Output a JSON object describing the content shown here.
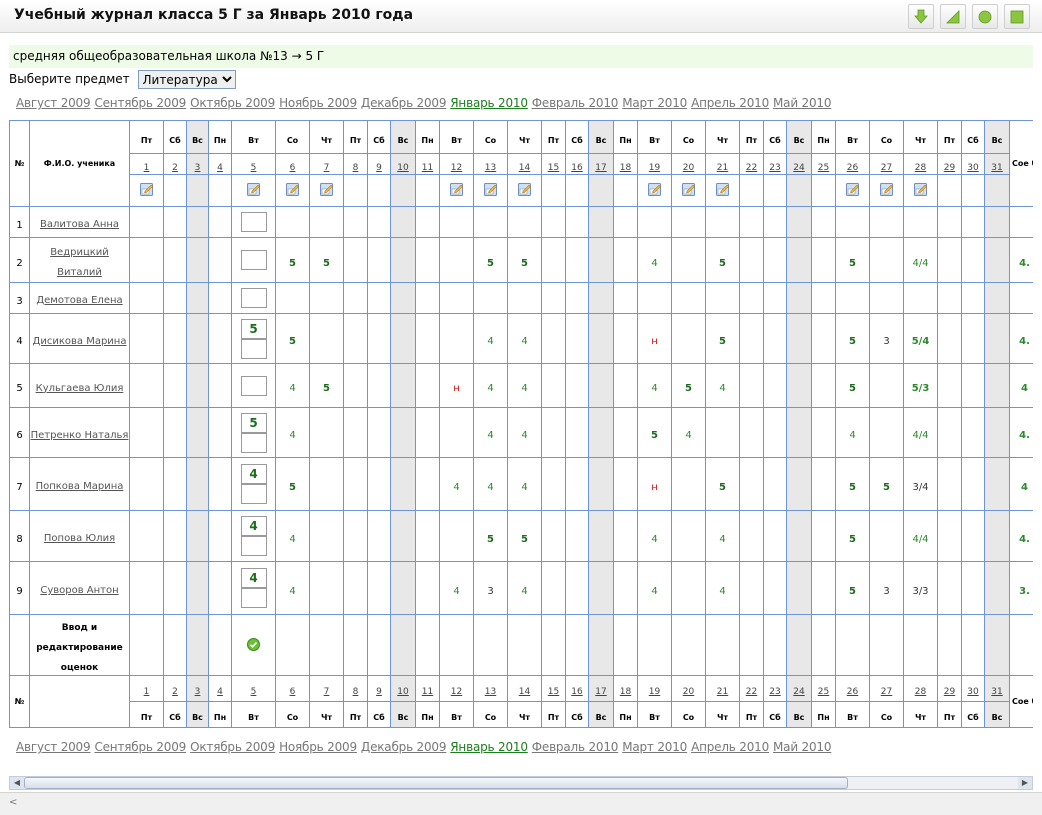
{
  "title": "Учебный журнал класса 5 Г за Январь 2010 года",
  "toolbar": {
    "icons": [
      "download-arrow-icon",
      "resize-corner-icon",
      "green-circle-icon",
      "green-square-icon"
    ]
  },
  "school_line": "средняя общеобразовательная школа №13 → 5 Г",
  "subject": {
    "label": "Выберите предмет",
    "selected": "Литература"
  },
  "months": [
    {
      "label": "Август 2009",
      "current": false
    },
    {
      "label": "Сентябрь 2009",
      "current": false
    },
    {
      "label": "Октябрь 2009",
      "current": false
    },
    {
      "label": "Ноябрь 2009",
      "current": false
    },
    {
      "label": "Декабрь 2009",
      "current": false
    },
    {
      "label": "Январь 2010",
      "current": true
    },
    {
      "label": "Февраль 2010",
      "current": false
    },
    {
      "label": "Март 2010",
      "current": false
    },
    {
      "label": "Апрель 2010",
      "current": false
    },
    {
      "label": "Май 2010",
      "current": false
    }
  ],
  "table": {
    "col_num": "№",
    "col_name": "Ф.И.О. ученика",
    "col_avg": "Сое ба",
    "days": [
      {
        "n": "1",
        "dow": "Пт",
        "sun": false,
        "edit": true
      },
      {
        "n": "2",
        "dow": "Сб",
        "sun": false,
        "edit": false
      },
      {
        "n": "3",
        "dow": "Вс",
        "sun": true,
        "edit": false
      },
      {
        "n": "4",
        "dow": "Пн",
        "sun": false,
        "edit": false
      },
      {
        "n": "5",
        "dow": "Вт",
        "sun": false,
        "edit": true
      },
      {
        "n": "6",
        "dow": "Со",
        "sun": false,
        "edit": true
      },
      {
        "n": "7",
        "dow": "Чт",
        "sun": false,
        "edit": true
      },
      {
        "n": "8",
        "dow": "Пт",
        "sun": false,
        "edit": false
      },
      {
        "n": "9",
        "dow": "Сб",
        "sun": false,
        "edit": false
      },
      {
        "n": "10",
        "dow": "Вс",
        "sun": true,
        "edit": false
      },
      {
        "n": "11",
        "dow": "Пн",
        "sun": false,
        "edit": false
      },
      {
        "n": "12",
        "dow": "Вт",
        "sun": false,
        "edit": true
      },
      {
        "n": "13",
        "dow": "Со",
        "sun": false,
        "edit": true
      },
      {
        "n": "14",
        "dow": "Чт",
        "sun": false,
        "edit": true
      },
      {
        "n": "15",
        "dow": "Пт",
        "sun": false,
        "edit": false
      },
      {
        "n": "16",
        "dow": "Сб",
        "sun": false,
        "edit": false
      },
      {
        "n": "17",
        "dow": "Вс",
        "sun": true,
        "edit": false
      },
      {
        "n": "18",
        "dow": "Пн",
        "sun": false,
        "edit": false
      },
      {
        "n": "19",
        "dow": "Вт",
        "sun": false,
        "edit": true
      },
      {
        "n": "20",
        "dow": "Со",
        "sun": false,
        "edit": true
      },
      {
        "n": "21",
        "dow": "Чт",
        "sun": false,
        "edit": true
      },
      {
        "n": "22",
        "dow": "Пт",
        "sun": false,
        "edit": false
      },
      {
        "n": "23",
        "dow": "Сб",
        "sun": false,
        "edit": false
      },
      {
        "n": "24",
        "dow": "Вс",
        "sun": true,
        "edit": false
      },
      {
        "n": "25",
        "dow": "Пн",
        "sun": false,
        "edit": false
      },
      {
        "n": "26",
        "dow": "Вт",
        "sun": false,
        "edit": true
      },
      {
        "n": "27",
        "dow": "Со",
        "sun": false,
        "edit": true
      },
      {
        "n": "28",
        "dow": "Чт",
        "sun": false,
        "edit": true
      },
      {
        "n": "29",
        "dow": "Пт",
        "sun": false,
        "edit": false
      },
      {
        "n": "30",
        "dow": "Сб",
        "sun": false,
        "edit": false
      },
      {
        "n": "31",
        "dow": "Вс",
        "sun": true,
        "edit": false
      }
    ],
    "students": [
      {
        "n": "1",
        "name": "Валитова Анна",
        "input": [
          ""
        ],
        "avg": "",
        "grades": {}
      },
      {
        "n": "2",
        "name": "Ведрицкий Виталий",
        "input": [
          ""
        ],
        "avg": "4.",
        "grades": {
          "6": "5",
          "7": "5",
          "13": "5",
          "14": "5",
          "19": "4",
          "21": "5",
          "26": "5",
          "28": "4/4"
        }
      },
      {
        "n": "3",
        "name": "Демотова Елена",
        "input": [
          ""
        ],
        "avg": "",
        "grades": {}
      },
      {
        "n": "4",
        "name": "Дисикова Марина",
        "input": [
          "5",
          ""
        ],
        "avg": "4.",
        "grades": {
          "6": "5",
          "13": "4",
          "14": "4",
          "19": "н",
          "21": "5",
          "26": "5",
          "27": "3",
          "28": "5/4"
        }
      },
      {
        "n": "5",
        "name": "Кульгаева Юлия",
        "input": [
          ""
        ],
        "avg": "4",
        "grades": {
          "6": "4",
          "7": "5",
          "12": "н",
          "13": "4",
          "14": "4",
          "19": "4",
          "20": "5",
          "21": "4",
          "26": "5",
          "28": "5/3"
        }
      },
      {
        "n": "6",
        "name": "Петренко Наталья",
        "input": [
          "5",
          ""
        ],
        "avg": "4.",
        "grades": {
          "6": "4",
          "13": "4",
          "14": "4",
          "19": "5",
          "20": "4",
          "26": "4",
          "28": "4/4"
        }
      },
      {
        "n": "7",
        "name": "Попкова Марина",
        "input": [
          "4",
          ""
        ],
        "avg": "4",
        "grades": {
          "6": "5",
          "12": "4",
          "13": "4",
          "14": "4",
          "19": "н",
          "21": "5",
          "26": "5",
          "27": "5",
          "28": "3/4"
        }
      },
      {
        "n": "8",
        "name": "Попова Юлия",
        "input": [
          "4",
          ""
        ],
        "avg": "4.",
        "grades": {
          "6": "4",
          "13": "5",
          "14": "5",
          "19": "4",
          "21": "4",
          "26": "5",
          "28": "4/4"
        }
      },
      {
        "n": "9",
        "name": "Суворов Антон",
        "input": [
          "4",
          ""
        ],
        "avg": "3.",
        "grades": {
          "6": "4",
          "12": "4",
          "13": "3",
          "14": "4",
          "19": "4",
          "21": "4",
          "26": "5",
          "27": "3",
          "28": "3/3"
        }
      }
    ],
    "footer_label": "Ввод и редактирование оценок"
  },
  "status": "<"
}
